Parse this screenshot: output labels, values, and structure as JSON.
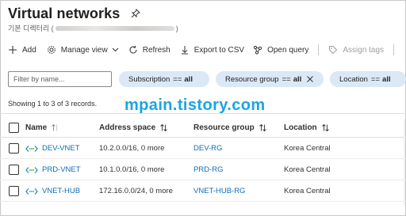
{
  "header": {
    "title": "Virtual networks",
    "subtitle_prefix": "기본 디렉터리 (",
    "subtitle_suffix": ")"
  },
  "toolbar": {
    "add": "Add",
    "manage_view": "Manage view",
    "refresh": "Refresh",
    "export_csv": "Export to CSV",
    "open_query": "Open query",
    "assign_tags": "Assign tags"
  },
  "filters": {
    "search_placeholder": "Filter by name...",
    "pills": [
      {
        "label": "Subscription",
        "op": "==",
        "value": "all"
      },
      {
        "label": "Resource group",
        "op": "==",
        "value": "all"
      },
      {
        "label": "Location",
        "op": "==",
        "value": "all"
      }
    ]
  },
  "summary": {
    "count_text": "Showing 1 to 3 of 3 records."
  },
  "watermark": "mpain.tistory.com",
  "table": {
    "columns": [
      "Name",
      "Address space",
      "Resource group",
      "Location"
    ],
    "rows": [
      {
        "name": "DEV-VNET",
        "address": "10.2.0.0/16, 0 more",
        "rg": "DEV-RG",
        "location": "Korea Central"
      },
      {
        "name": "PRD-VNET",
        "address": "10.1.0.0/16, 0 more",
        "rg": "PRD-RG",
        "location": "Korea Central"
      },
      {
        "name": "VNET-HUB",
        "address": "172.16.0.0/24, 0 more",
        "rg": "VNET-HUB-RG",
        "location": "Korea Central"
      }
    ]
  },
  "colors": {
    "link": "#0f6cbd",
    "pill_bg": "#dbe8f6",
    "watermark": "#1aa5e0"
  }
}
